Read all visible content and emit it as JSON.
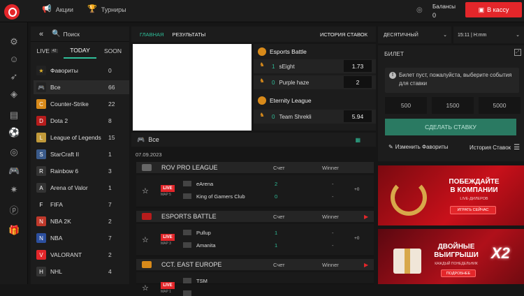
{
  "topbar": {
    "promos": "Акции",
    "tournaments": "Турниры",
    "balances_label": "Балансы",
    "balances_value": "0",
    "deposit": "В кассу"
  },
  "sports_panel": {
    "search_placeholder": "Поиск",
    "tabs": {
      "live": "LIVE",
      "live_count": "42",
      "today": "TODAY",
      "soon": "SOON"
    },
    "items": [
      {
        "name": "Фавориты",
        "count": "0",
        "color": "#222",
        "glyph": "★"
      },
      {
        "name": "Все",
        "count": "66",
        "color": "#222",
        "glyph": "🎮"
      },
      {
        "name": "Counter-Strike",
        "count": "22",
        "color": "#d88a1a",
        "glyph": "C"
      },
      {
        "name": "Dota 2",
        "count": "8",
        "color": "#b71c1c",
        "glyph": "D"
      },
      {
        "name": "League of Legends",
        "count": "15",
        "color": "#c19a3a",
        "glyph": "L"
      },
      {
        "name": "StarCraft II",
        "count": "1",
        "color": "#3a5a8a",
        "glyph": "S"
      },
      {
        "name": "Rainbow 6",
        "count": "3",
        "color": "#333",
        "glyph": "R"
      },
      {
        "name": "Arena of Valor",
        "count": "1",
        "color": "#333",
        "glyph": "A"
      },
      {
        "name": "FIFA",
        "count": "7",
        "color": "#1c1c1c",
        "glyph": "F"
      },
      {
        "name": "NBA 2K",
        "count": "2",
        "color": "#c0392b",
        "glyph": "N"
      },
      {
        "name": "NBA",
        "count": "7",
        "color": "#2c4f9e",
        "glyph": "N"
      },
      {
        "name": "VALORANT",
        "count": "2",
        "color": "#e3262a",
        "glyph": "V"
      },
      {
        "name": "NHL",
        "count": "4",
        "color": "#333",
        "glyph": "H"
      }
    ]
  },
  "center": {
    "tab_main": "ГЛАВНАЯ",
    "tab_results": "РЕЗУЛЬТАТЫ",
    "bet_history": "История ставок",
    "featured": [
      {
        "league": "Esports Battle",
        "rows": [
          {
            "n": "1",
            "team": "sEight",
            "odd": "1.73"
          },
          {
            "n": "0",
            "team": "Purple haze",
            "odd": "2"
          }
        ]
      },
      {
        "league": "Eternity League",
        "rows": [
          {
            "n": "0",
            "team": "Team Shrekli",
            "odd": "5.94"
          }
        ]
      }
    ],
    "all_label": "Все",
    "date": "07.09.2023",
    "score_label": "Счет",
    "winner_label": "Winner",
    "leagues": [
      {
        "name": "ROV PRO LEAGUE",
        "live": "LIVE",
        "map": "MAP 5",
        "team1": "eArena",
        "team2": "King of Gamers Club",
        "s1": "2",
        "s2": "0",
        "dash1": "-",
        "dash2": "-",
        "more": "+0"
      },
      {
        "name": "ESPORTS BATTLE",
        "live": "LIVE",
        "map": "MAP 3",
        "team1": "Pullup",
        "team2": "Amanita",
        "s1": "1",
        "s2": "1",
        "dash1": "-",
        "dash2": "-",
        "more": "+0"
      },
      {
        "name": "CCT. EAST EUROPE",
        "live": "LIVE",
        "map": "MAP 1",
        "team1": "TSM",
        "team2": "",
        "s1": "",
        "s2": "",
        "dash1": "",
        "dash2": "",
        "more": ""
      }
    ]
  },
  "right": {
    "odds_format": "Десятичный",
    "time_format": "15:11 | H:mm",
    "ticket_title": "БИЛЕТ",
    "ticket_empty": "Билет пуст, пожалуйста, выберите события для ставки",
    "amounts": [
      "500",
      "1500",
      "5000"
    ],
    "make_bet": "СДЕЛАТЬ СТАВКУ",
    "edit_favorites": "Изменить Фавориты",
    "bet_history": "История Ставок",
    "banner1": {
      "line1": "ПОБЕЖДАЙТЕ",
      "line2": "В КОМПАНИИ",
      "line3": "LIVE-ДИЛЕРОВ",
      "button": "ИГРАТЬ СЕЙЧАС"
    },
    "banner2": {
      "line1": "ДВОЙНЫЕ",
      "line2": "ВЫИГРЫШИ",
      "line3": "КАЖДЫЙ ПОНЕДЕЛЬНИК",
      "button": "ПОДРОБНЕЕ",
      "badge": "X2"
    }
  }
}
